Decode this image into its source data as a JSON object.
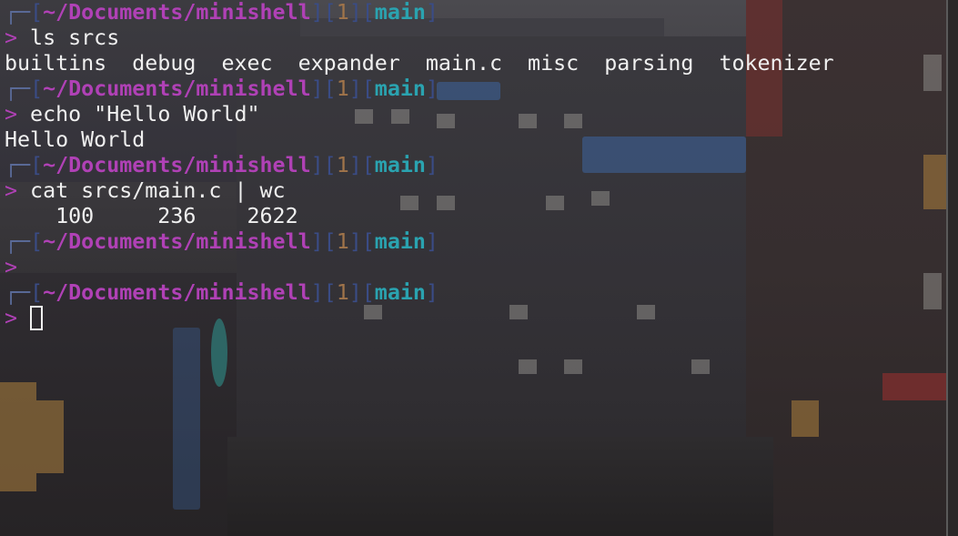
{
  "prompt": {
    "corner": "┌─",
    "open_bracket": "[",
    "close_bracket": "]",
    "path": "~/Documents/minishell",
    "exit_code": "1",
    "branch": "main",
    "arrow": ">"
  },
  "history": [
    {
      "command": " ls srcs",
      "output": [
        "builtins  debug  exec  expander  main.c  misc  parsing  tokenizer"
      ]
    },
    {
      "command": " echo \"Hello World\"",
      "output": [
        "Hello World"
      ]
    },
    {
      "command": " cat srcs/main.c | wc",
      "output": [
        "    100     236    2622"
      ]
    },
    {
      "command": "",
      "output": []
    }
  ],
  "current_input": " "
}
